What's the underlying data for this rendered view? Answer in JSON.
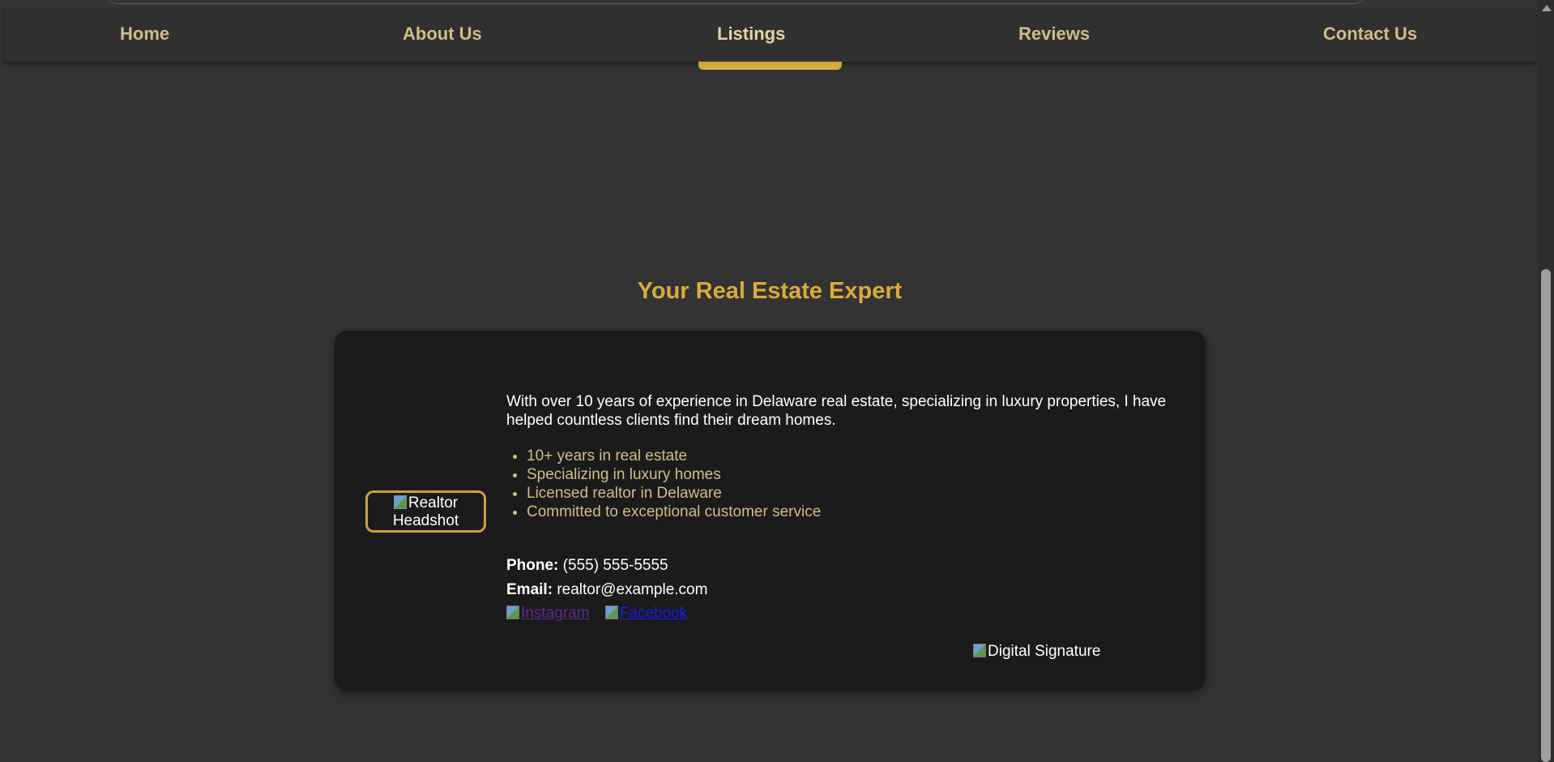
{
  "nav": {
    "items": [
      {
        "label": "Home"
      },
      {
        "label": "About Us"
      },
      {
        "label": "Listings"
      },
      {
        "label": "Reviews"
      },
      {
        "label": "Contact Us"
      }
    ],
    "active": "Listings"
  },
  "section": {
    "title": "Your Real Estate Expert"
  },
  "profile": {
    "headshot_alt": "Realtor Headshot",
    "bio": "With over 10 years of experience in Delaware real estate, specializing in luxury properties, I have helped countless clients find their dream homes.",
    "highlights": [
      "10+ years in real estate",
      "Specializing in luxury homes",
      "Licensed realtor in Delaware",
      "Committed to exceptional customer service"
    ],
    "phone_label": "Phone:",
    "phone": "(555) 555-5555",
    "email_label": "Email:",
    "email": "realtor@example.com",
    "social": {
      "instagram_alt": "Instagram",
      "facebook_alt": "Facebook"
    },
    "signature_alt": "Digital Signature"
  },
  "colors": {
    "background": "#333333",
    "card": "#1b1b1b",
    "accent_gold": "#d9ab3a",
    "nav_text": "#d2bc85"
  }
}
